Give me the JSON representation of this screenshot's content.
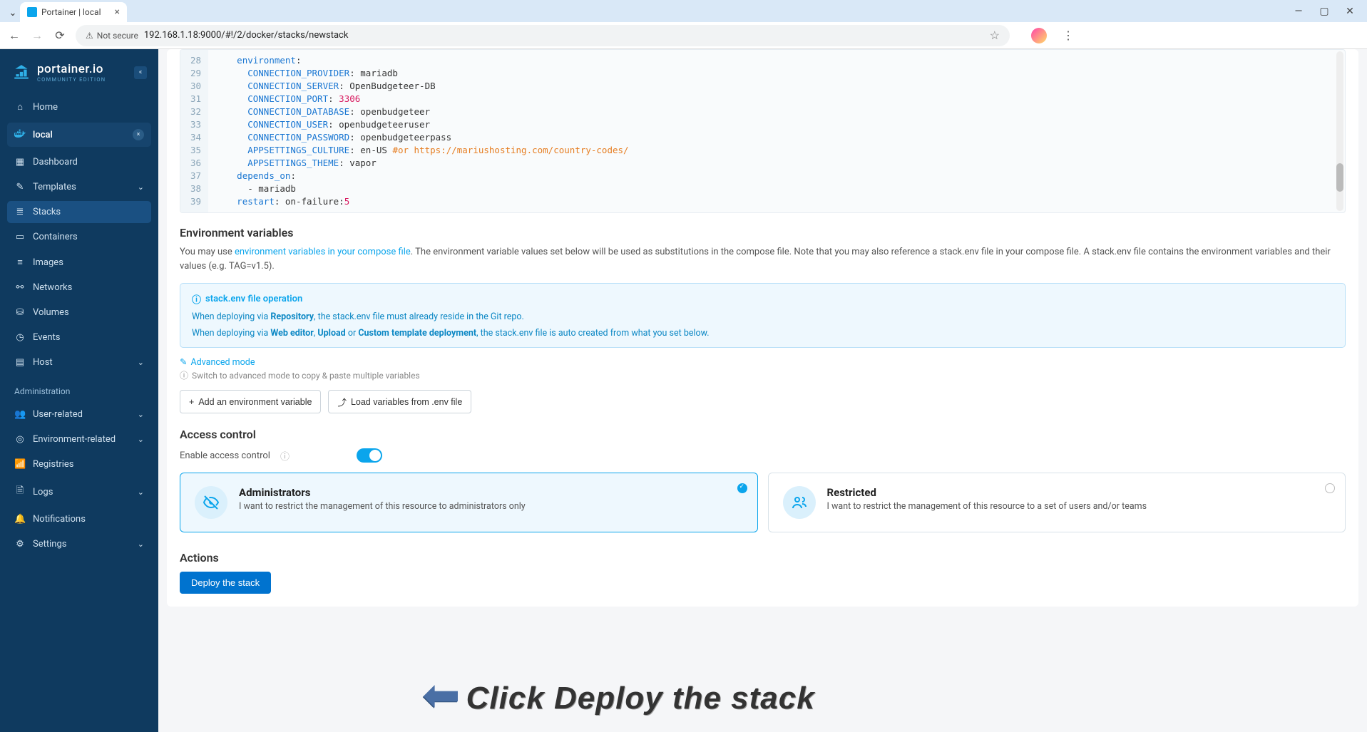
{
  "browser": {
    "tab_title": "Portainer | local",
    "url_security": "Not secure",
    "url": "192.168.1.18:9000/#!/2/docker/stacks/newstack"
  },
  "logo": {
    "brand": "portainer.io",
    "sub": "COMMUNITY EDITION"
  },
  "sidebar": {
    "home": "Home",
    "env_label": "local",
    "items": [
      "Dashboard",
      "Templates",
      "Stacks",
      "Containers",
      "Images",
      "Networks",
      "Volumes",
      "Events",
      "Host"
    ],
    "admin_header": "Administration",
    "admin_items": [
      "User-related",
      "Environment-related",
      "Registries",
      "Logs",
      "Notifications",
      "Settings"
    ]
  },
  "editor": {
    "lines": [
      {
        "n": 28,
        "indent": "    ",
        "key": "environment",
        "val": ":"
      },
      {
        "n": 29,
        "indent": "      ",
        "key": "CONNECTION_PROVIDER",
        "val": ": mariadb"
      },
      {
        "n": 30,
        "indent": "      ",
        "key": "CONNECTION_SERVER",
        "val": ": OpenBudgeteer-DB"
      },
      {
        "n": 31,
        "indent": "      ",
        "key": "CONNECTION_PORT",
        "val": ": ",
        "num": "3306"
      },
      {
        "n": 32,
        "indent": "      ",
        "key": "CONNECTION_DATABASE",
        "val": ": openbudgeteer"
      },
      {
        "n": 33,
        "indent": "      ",
        "key": "CONNECTION_USER",
        "val": ": openbudgeteeruser"
      },
      {
        "n": 34,
        "indent": "      ",
        "key": "CONNECTION_PASSWORD",
        "val": ": openbudgeteerpass"
      },
      {
        "n": 35,
        "indent": "      ",
        "key": "APPSETTINGS_CULTURE",
        "val": ": en-US ",
        "com": "#or https://mariushosting.com/country-codes/"
      },
      {
        "n": 36,
        "indent": "      ",
        "key": "APPSETTINGS_THEME",
        "val": ": vapor"
      },
      {
        "n": 37,
        "indent": "    ",
        "key": "depends_on",
        "val": ":"
      },
      {
        "n": 38,
        "indent": "      ",
        "plain": "- mariadb"
      },
      {
        "n": 39,
        "indent": "    ",
        "key": "restart",
        "val": ": on-failure:",
        "num": "5"
      }
    ]
  },
  "env_section": {
    "title": "Environment variables",
    "help_pre": "You may use ",
    "help_link": "environment variables in your compose file",
    "help_post": ". The environment variable values set below will be used as substitutions in the compose file. Note that you may also reference a stack.env file in your compose file. A stack.env file contains the environment variables and their values (e.g. TAG=v1.5).",
    "info_title": "stack.env file operation",
    "info_line1_pre": "When deploying via ",
    "info_line1_b1": "Repository",
    "info_line1_post": ", the stack.env file must already reside in the Git repo.",
    "info_line2_pre": "When deploying via ",
    "info_line2_b1": "Web editor",
    "info_line2_mid1": ", ",
    "info_line2_b2": "Upload",
    "info_line2_mid2": " or ",
    "info_line2_b3": "Custom template deployment",
    "info_line2_post": ", the stack.env file is auto created from what you set below.",
    "adv_link": "Advanced mode",
    "adv_hint": "Switch to advanced mode to copy & paste multiple variables",
    "btn_add": "Add an environment variable",
    "btn_load": "Load variables from .env file"
  },
  "access": {
    "title": "Access control",
    "enable_label": "Enable access control",
    "admins_title": "Administrators",
    "admins_desc": "I want to restrict the management of this resource to administrators only",
    "restricted_title": "Restricted",
    "restricted_desc": "I want to restrict the management of this resource to a set of users and/or teams"
  },
  "actions": {
    "title": "Actions",
    "deploy": "Deploy the stack"
  },
  "annotation": "Click Deploy the stack"
}
